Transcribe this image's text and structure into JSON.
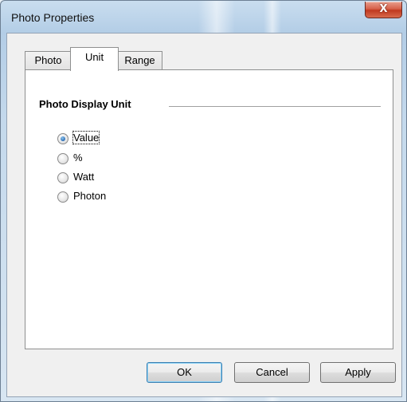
{
  "window": {
    "title": "Photo Properties",
    "close_icon": "close-icon",
    "close_glyph": "X"
  },
  "tabs": [
    {
      "label": "Photo",
      "selected": false
    },
    {
      "label": "Unit",
      "selected": true
    },
    {
      "label": "Range",
      "selected": false
    }
  ],
  "panel": {
    "section_title": "Photo Display Unit",
    "options": [
      {
        "label": "Value",
        "selected": true
      },
      {
        "label": "%",
        "selected": false
      },
      {
        "label": "Watt",
        "selected": false
      },
      {
        "label": "Photon",
        "selected": false
      }
    ]
  },
  "buttons": {
    "ok": "OK",
    "cancel": "Cancel",
    "apply": "Apply"
  },
  "colors": {
    "close_button": "#c7432a",
    "default_button_border": "#3c7fb1",
    "radio_selected": "#2b6cb4"
  }
}
